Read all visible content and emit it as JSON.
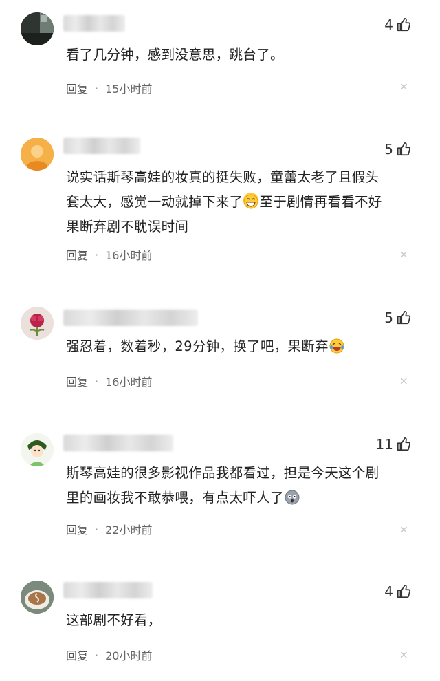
{
  "comments": [
    {
      "likes": "4",
      "lines": [
        "看了几分钟，感到没意思，跳台了。"
      ],
      "reply_label": "回复",
      "separator": "·",
      "time": "15小时前",
      "close_glyph": "×",
      "avatar_icon": "user-avatar-photo"
    },
    {
      "likes": "5",
      "lines": [
        "说实话斯琴高娃的妆真的挺失败，童蕾太老了且假头",
        "套太大，感觉一动就掉下来了",
        "至于剧情再看看不好",
        "果断弃剧不耽误时间"
      ],
      "reply_label": "回复",
      "separator": "·",
      "time": "16小时前",
      "close_glyph": "×",
      "avatar_icon": "user-avatar-orange"
    },
    {
      "likes": "5",
      "lines": [
        "强忍着，数着秒，29分钟，换了吧，果断弃"
      ],
      "reply_label": "回复",
      "separator": "·",
      "time": "16小时前",
      "close_glyph": "×",
      "avatar_icon": "user-avatar-flower"
    },
    {
      "likes": "11",
      "lines": [
        "斯琴高娃的很多影视作品我都看过，担是今天这个剧",
        "里的画妆我不敢恭喂，有点太吓人了"
      ],
      "reply_label": "回复",
      "separator": "·",
      "time": "22小时前",
      "close_glyph": "×",
      "avatar_icon": "user-avatar-cartoon"
    },
    {
      "likes": "4",
      "lines": [
        "这部剧不好看，"
      ],
      "reply_label": "回复",
      "separator": "·",
      "time": "20小时前",
      "close_glyph": "×",
      "avatar_icon": "user-avatar-coffee"
    }
  ],
  "colors": {
    "text": "#222222",
    "meta": "#555555",
    "close": "#c8c8c8"
  }
}
